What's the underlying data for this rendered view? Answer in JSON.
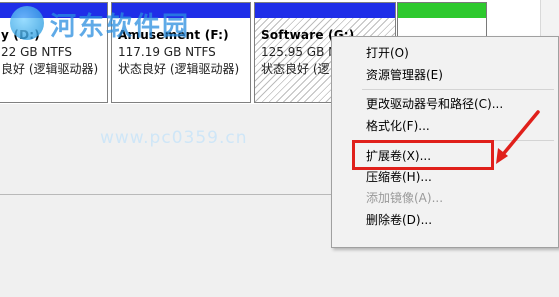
{
  "watermark": {
    "title": "河东软件园",
    "url": "www.pc0359.cn"
  },
  "partitions": [
    {
      "name": "y (D:)",
      "size": "22 GB NTFS",
      "status": "良好 (逻辑驱动器)"
    },
    {
      "name": "Amusement (F:)",
      "size": "117.19 GB NTFS",
      "status": "状态良好 (逻辑驱动器)"
    },
    {
      "name": "Software (G:)",
      "size": "125.95 GB N",
      "status": "状态良好 (逻"
    }
  ],
  "context_menu": {
    "items": [
      {
        "label": "打开(O)",
        "enabled": true
      },
      {
        "label": "资源管理器(E)",
        "enabled": true
      },
      {
        "label": "更改驱动器号和路径(C)...",
        "enabled": true
      },
      {
        "label": "格式化(F)...",
        "enabled": true
      },
      {
        "label": "扩展卷(X)...",
        "enabled": true,
        "highlighted": true
      },
      {
        "label": "压缩卷(H)...",
        "enabled": true
      },
      {
        "label": "添加镜像(A)...",
        "enabled": false
      },
      {
        "label": "删除卷(D)...",
        "enabled": true
      }
    ]
  },
  "colors": {
    "partition_bar": "#1f2ee8",
    "free_space_bar": "#2ec92e",
    "annotation": "#e0201b"
  }
}
